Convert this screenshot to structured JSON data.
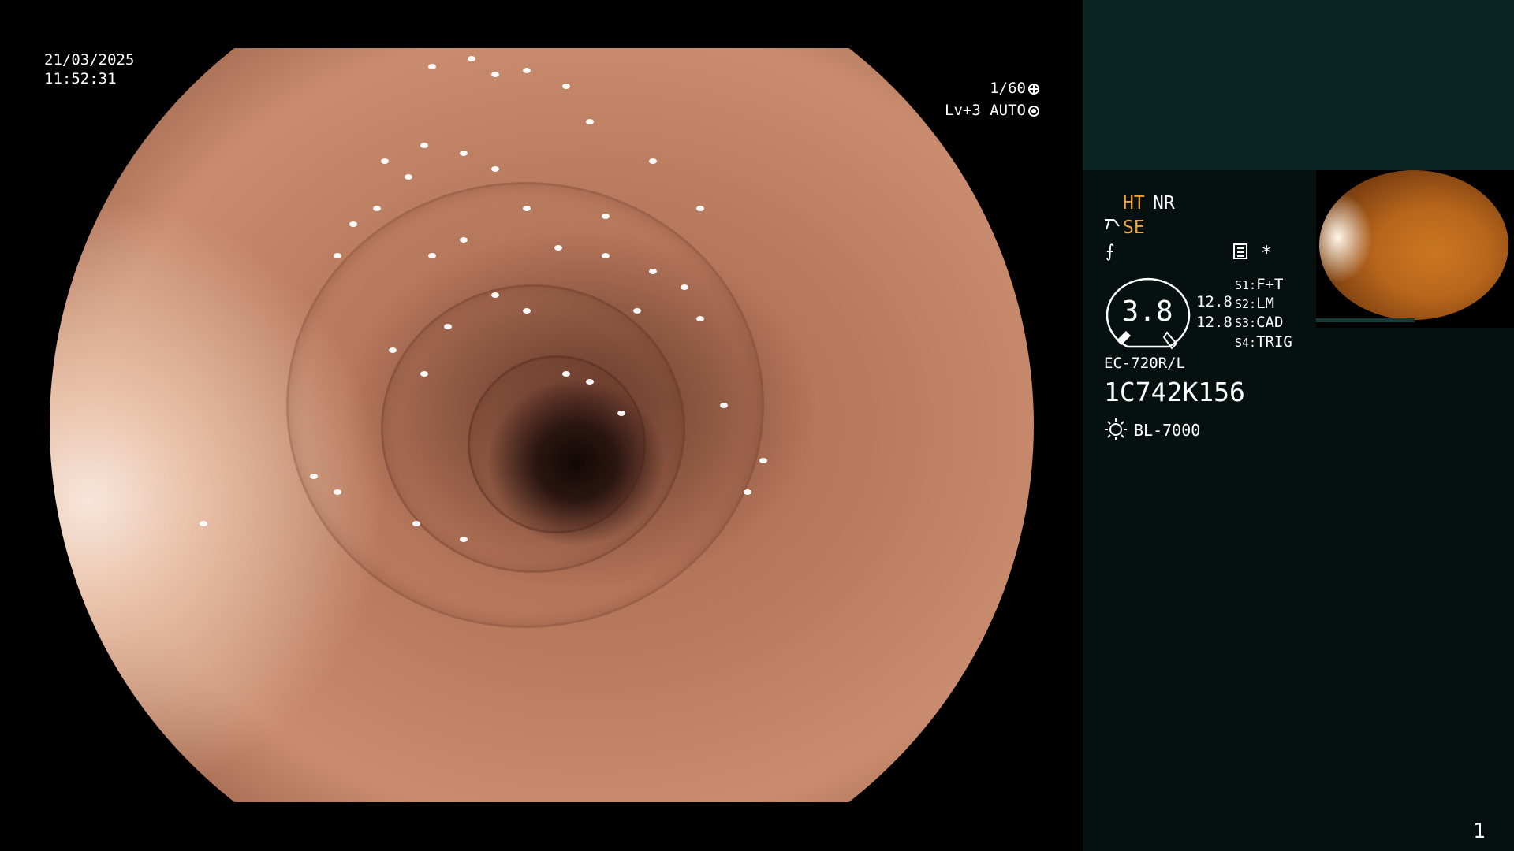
{
  "overlay": {
    "date": "21/03/2025",
    "time": "11:52:31",
    "shutter": "1/60",
    "level": "Lv+3 AUTO"
  },
  "panel": {
    "ht": "HT",
    "nr": "NR",
    "se": "SE",
    "gauge_value": "3.8",
    "value_a": "12.8",
    "value_b": "12.8",
    "switches": [
      {
        "key": "S1:",
        "value": "F+T"
      },
      {
        "key": "S2:",
        "value": "LM"
      },
      {
        "key": "S3:",
        "value": "CAD"
      },
      {
        "key": "S4:",
        "value": "TRIG"
      }
    ],
    "scope_model": "EC-720R/L",
    "scope_serial": "1C742K156",
    "light_source": "BL-7000",
    "page_number": "1"
  },
  "colors": {
    "accent_orange": "#f3a533",
    "panel_bg": "#06110f",
    "panel_top_bg": "#0a2624"
  },
  "icons": [
    "shutter-icon",
    "auto-iris-icon",
    "se-icon",
    "f-icon",
    "menu-icon",
    "asterisk-icon",
    "light-source-icon"
  ]
}
